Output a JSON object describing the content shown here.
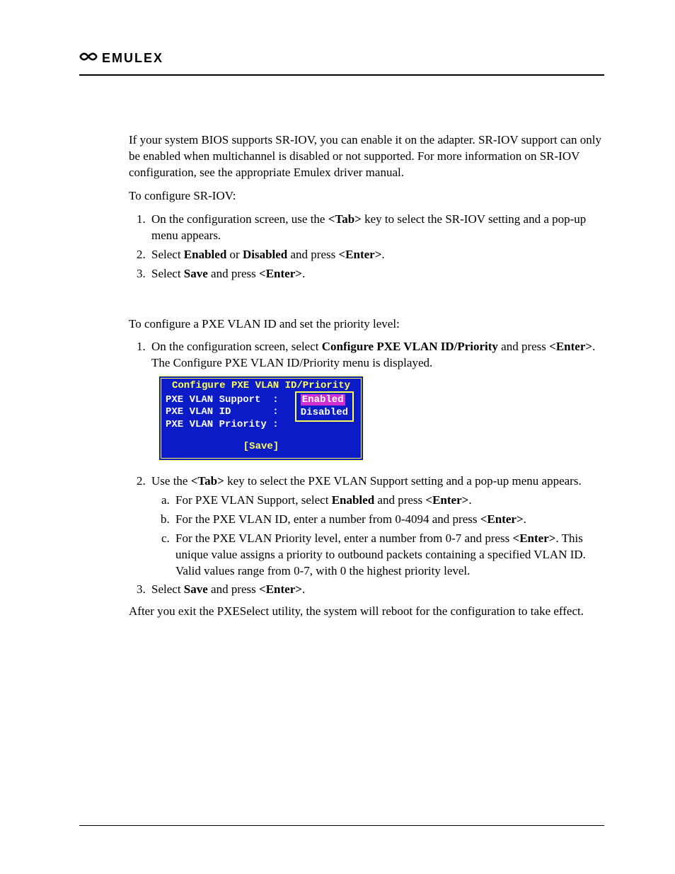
{
  "brand": {
    "name": "EMULEX"
  },
  "intro": {
    "p1": "If your system BIOS supports SR-IOV, you can enable it on the adapter. SR-IOV support can only be enabled when multichannel is disabled or not supported. For more information on SR-IOV configuration, see the appropriate Emulex driver manual.",
    "p2": "To configure SR-IOV:"
  },
  "sriov_steps": {
    "s1_a": "On the configuration screen, use the ",
    "s1_b": "<Tab>",
    "s1_c": " key to select the SR-IOV setting and a pop-up menu appears.",
    "s2_a": "Select ",
    "s2_b": "Enabled",
    "s2_c": " or ",
    "s2_d": "Disabled",
    "s2_e": " and press ",
    "s2_f": "<Enter>",
    "s2_g": ".",
    "s3_a": "Select ",
    "s3_b": "Save",
    "s3_c": " and press ",
    "s3_d": "<Enter>",
    "s3_e": "."
  },
  "pxe_intro": "To configure a PXE VLAN ID and set the priority level:",
  "pxe_step1": {
    "a": "On the configuration screen, select ",
    "b": "Configure PXE VLAN ID/Priority",
    "c": " and press ",
    "d": "<Enter>",
    "e": ". The Configure PXE VLAN ID/Priority menu is displayed."
  },
  "bios": {
    "title": "Configure PXE VLAN ID/Priority",
    "row1": "PXE VLAN Support  :",
    "row2": "PXE VLAN ID       :",
    "row3": "PXE VLAN Priority :",
    "popup_sel": "Enabled ",
    "popup_other": "Disabled",
    "save": "[Save]"
  },
  "pxe_step2": {
    "a": "Use the ",
    "b": "<Tab>",
    "c": " key to select the PXE VLAN Support setting and a pop-up menu appears."
  },
  "pxe_sub": {
    "a_a": "For PXE VLAN Support, select ",
    "a_b": "Enabled",
    "a_c": " and press ",
    "a_d": "<Enter>",
    "a_e": ".",
    "b_a": "For the PXE VLAN ID, enter a number from 0-4094 and press ",
    "b_b": "<Enter>",
    "b_c": ".",
    "c_a": "For the PXE VLAN Priority level, enter a number from 0-7 and press ",
    "c_b": "<Enter>",
    "c_c": ". This unique value assigns a priority to outbound packets containing a specified VLAN ID. Valid values range from 0-7, with 0 the highest priority level."
  },
  "pxe_step3": {
    "a": "Select ",
    "b": "Save",
    "c": " and press ",
    "d": "<Enter>",
    "e": "."
  },
  "outro": "After you exit the PXESelect utility, the system will reboot for the configuration to take effect."
}
